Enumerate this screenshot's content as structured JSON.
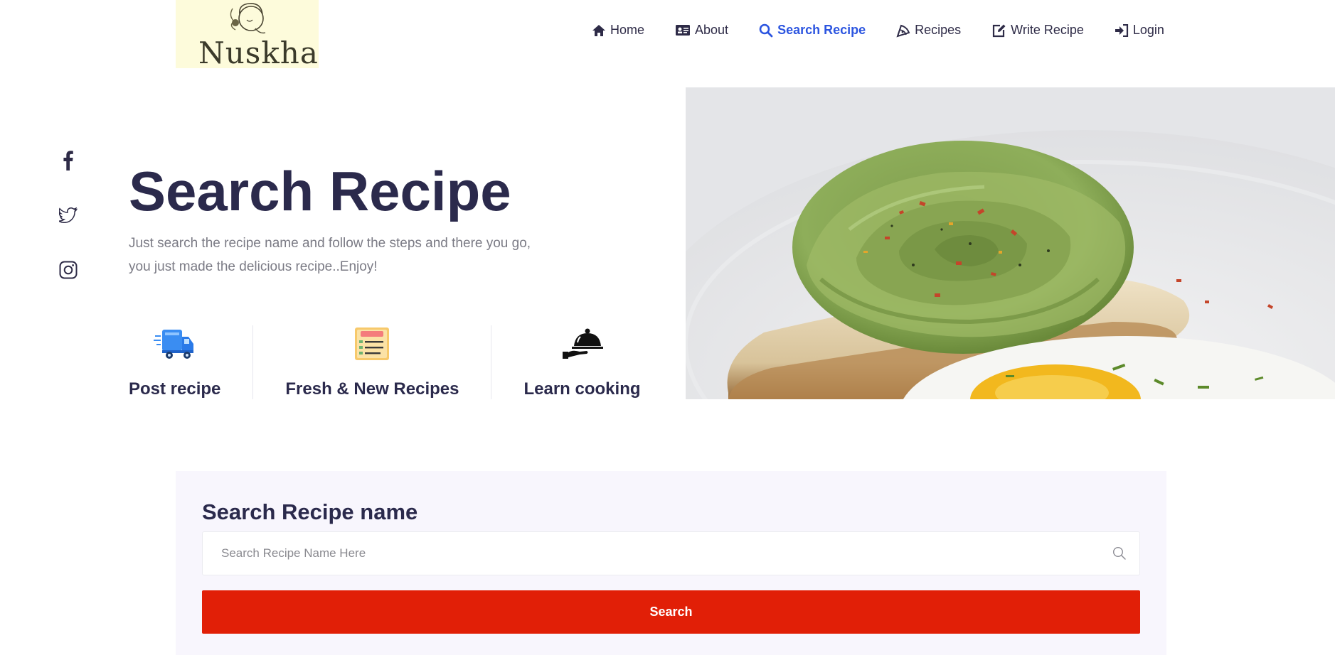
{
  "brand": {
    "name": "Nuskha",
    "bg": "#fdfbdb"
  },
  "nav": {
    "items": [
      {
        "label": "Home",
        "icon": "home-icon"
      },
      {
        "label": "About",
        "icon": "id-card-icon"
      },
      {
        "label": "Search Recipe",
        "icon": "search-icon",
        "active": true
      },
      {
        "label": "Recipes",
        "icon": "pizza-slice-icon"
      },
      {
        "label": "Write Recipe",
        "icon": "edit-icon"
      },
      {
        "label": "Login",
        "icon": "sign-in-icon"
      }
    ],
    "active_color": "#2c55e0"
  },
  "social": [
    "facebook-icon",
    "twitter-icon",
    "instagram-icon"
  ],
  "hero": {
    "title": "Search Recipe",
    "description": "Just search the recipe name and follow the steps and there you go, you just made the delicious recipe..Enjoy!",
    "image": "avocado-rose-toast-photo"
  },
  "features": [
    {
      "label": "Post recipe",
      "icon": "delivery-truck-icon"
    },
    {
      "label": "Fresh & New Recipes",
      "icon": "recipe-list-icon"
    },
    {
      "label": "Learn cooking",
      "icon": "serving-cloche-icon"
    }
  ],
  "search": {
    "title": "Search Recipe name",
    "placeholder": "Search Recipe Name Here",
    "button_label": "Search",
    "button_color": "#e11f07"
  }
}
